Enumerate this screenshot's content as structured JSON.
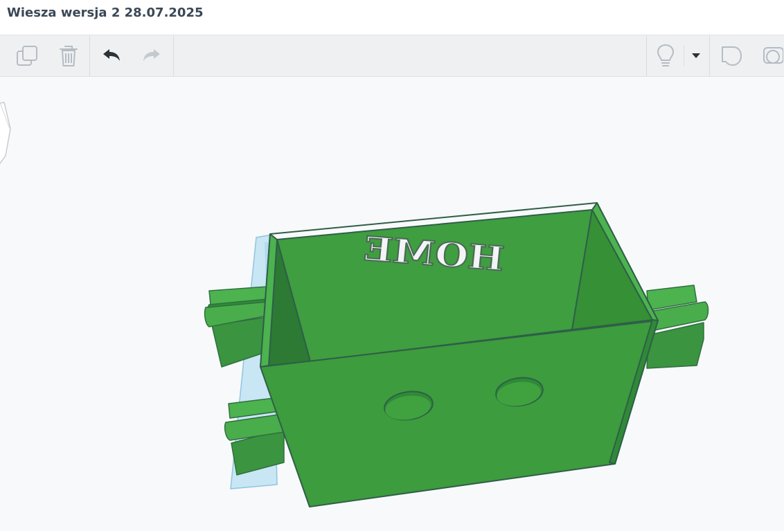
{
  "design": {
    "title": "Wiesza wersja 2 28.07.2025"
  },
  "toolbar": {
    "left_tools": [
      {
        "name": "copy",
        "icon": "copy-icon",
        "enabled": false
      },
      {
        "name": "delete",
        "icon": "trash-icon",
        "enabled": false
      },
      {
        "name": "undo",
        "icon": "undo-icon",
        "enabled": true
      },
      {
        "name": "redo",
        "icon": "redo-icon",
        "enabled": false
      }
    ],
    "right_tools": [
      {
        "name": "light",
        "icon": "lightbulb-icon"
      },
      {
        "name": "light-options",
        "icon": "caret-down-icon"
      },
      {
        "name": "note",
        "icon": "speech-shape-icon"
      },
      {
        "name": "shape",
        "icon": "shape-icon"
      }
    ]
  },
  "canvas": {
    "model_text": "HOME",
    "model_color": "#3d9c3d",
    "workplane_color": "#c9e6f4"
  },
  "colors": {
    "icon_disabled": "#b6bcc3",
    "icon_enabled": "#2b3338",
    "accent_green": "#3d9c3d"
  }
}
